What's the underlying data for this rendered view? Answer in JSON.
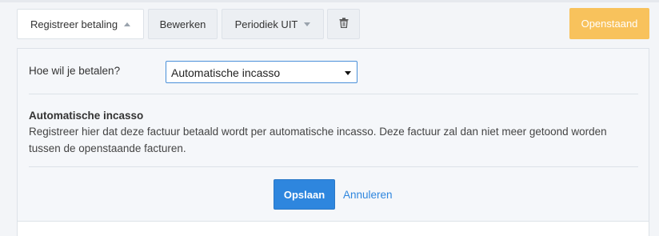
{
  "toolbar": {
    "register_label": "Registreer betaling",
    "edit_label": "Bewerken",
    "periodic_label": "Periodiek UIT",
    "status_label": "Openstaand",
    "delete_icon": "trash-icon"
  },
  "form": {
    "question_label": "Hoe wil je betalen?",
    "payment_method_value": "Automatische incasso"
  },
  "info": {
    "title": "Automatische incasso",
    "text": "Registreer hier dat deze factuur betaald wordt per automatische incasso. Deze factuur zal dan niet meer getoond worden tussen de openstaande facturen."
  },
  "actions": {
    "save_label": "Opslaan",
    "cancel_label": "Annuleren"
  },
  "colors": {
    "status_accent": "#f8c25c",
    "primary": "#2e86de"
  }
}
